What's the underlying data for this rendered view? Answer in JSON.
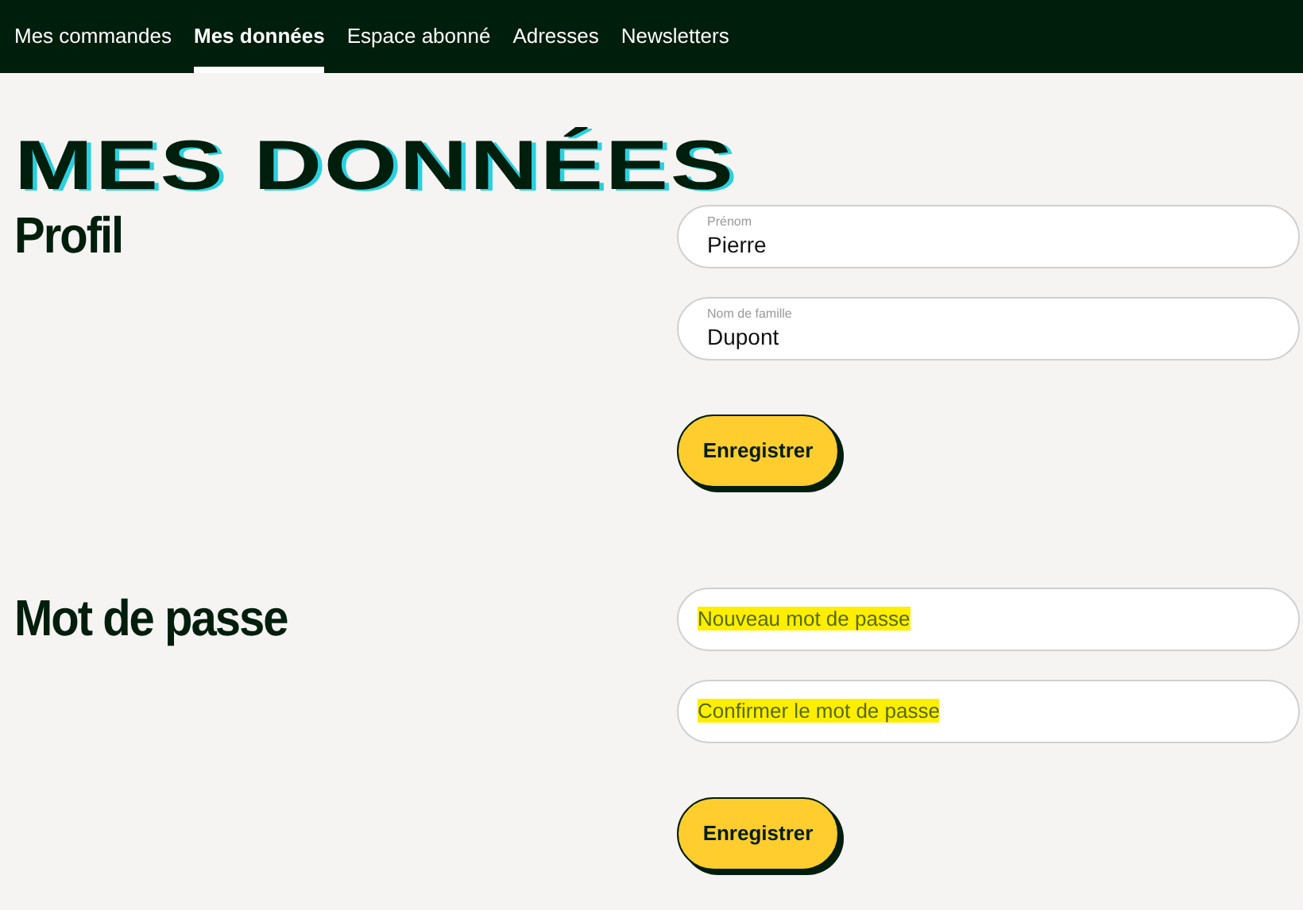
{
  "nav": {
    "tabs": [
      {
        "label": "Mes commandes",
        "selected": false
      },
      {
        "label": "Mes données",
        "selected": true
      },
      {
        "label": "Espace abonné",
        "selected": false
      },
      {
        "label": "Adresses",
        "selected": false
      },
      {
        "label": "Newsletters",
        "selected": false
      }
    ]
  },
  "title": "MES DONNÉES",
  "sections": [
    {
      "heading": "Profil",
      "fields": [
        {
          "label": "Prénom",
          "value": "Pierre"
        },
        {
          "label": "Nom de famille",
          "value": "Dupont"
        }
      ],
      "button": "Enregistrer"
    },
    {
      "heading": "Mot de passe",
      "fields": [
        {
          "placeholder": "Nouveau mot de passe",
          "highlighted": true
        },
        {
          "placeholder": "Confirmer le mot de passe",
          "highlighted": true
        }
      ],
      "button": "Enregistrer"
    }
  ]
}
